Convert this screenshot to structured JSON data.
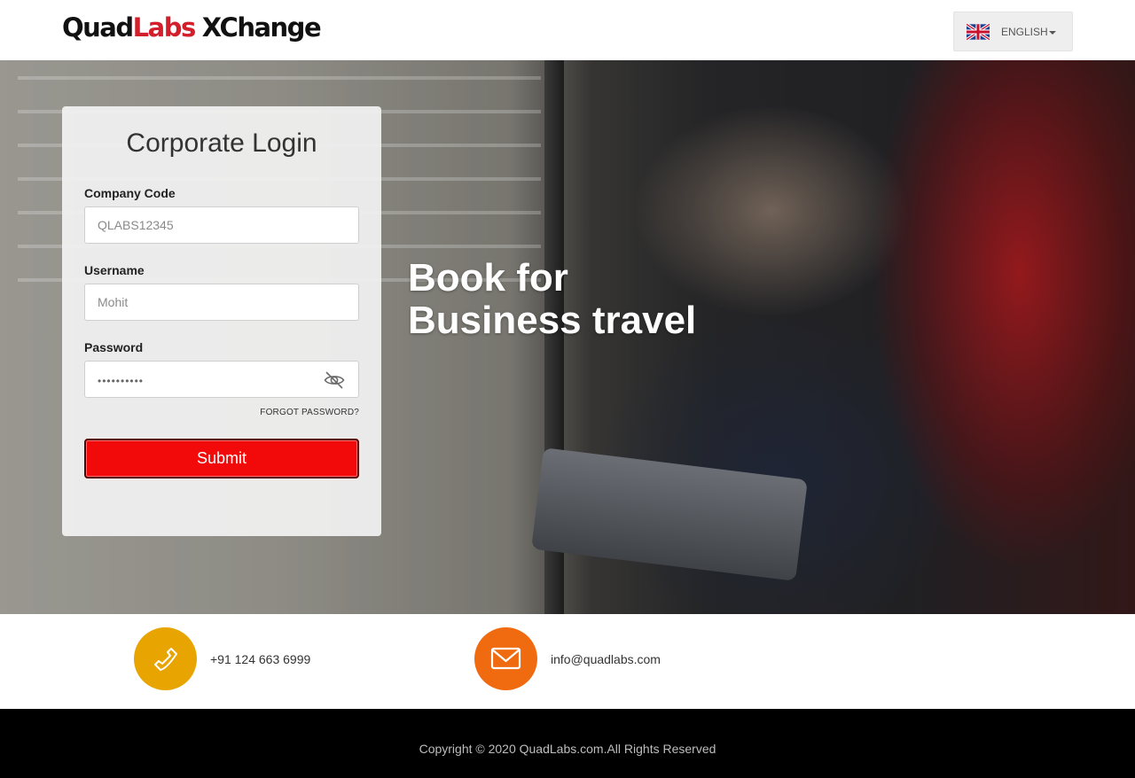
{
  "header": {
    "logo": {
      "quad": "Quad",
      "labs": "Labs",
      "xchange": "XChange"
    },
    "language": {
      "label": "ENGLISH",
      "flag_icon": "uk-flag-icon"
    }
  },
  "hero": {
    "headline_line1": "Book for",
    "headline_line2": "Business travel"
  },
  "login": {
    "title": "Corporate Login",
    "company_code": {
      "label": "Company Code",
      "placeholder": "QLABS12345"
    },
    "username": {
      "label": "Username",
      "placeholder": "Mohit"
    },
    "password": {
      "label": "Password",
      "masked_value": "••••••••••",
      "toggle_icon": "eye-off-icon"
    },
    "forgot_link": "FORGOT PASSWORD?",
    "submit_label": "Submit"
  },
  "contact": {
    "phone": {
      "icon": "phone-icon",
      "text": "+91 124 663 6999",
      "color": "#e8a400"
    },
    "email": {
      "icon": "mail-icon",
      "text": "info@quadlabs.com",
      "color": "#f06a10"
    }
  },
  "footer": {
    "copyright": "Copyright © 2020 QuadLabs.com.All Rights Reserved"
  },
  "colors": {
    "brand_red": "#d21f2b",
    "submit_red": "#f20a0a",
    "footer_bg": "#000000"
  }
}
